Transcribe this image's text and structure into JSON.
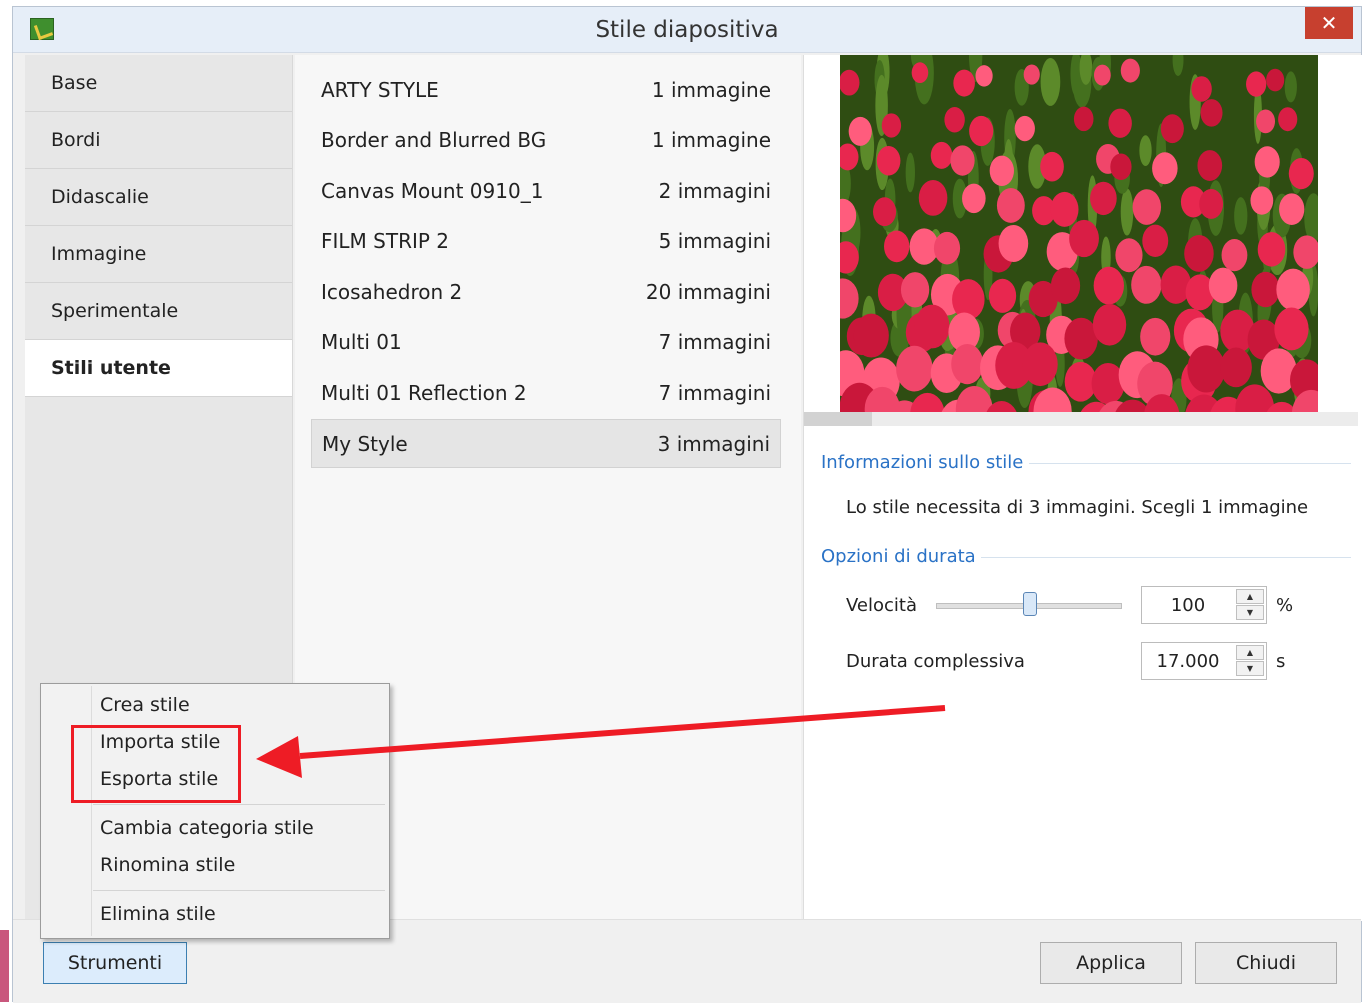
{
  "window": {
    "title": "Stile diapositiva",
    "close_glyph": "✕"
  },
  "sidebar": {
    "items": [
      {
        "label": "Base"
      },
      {
        "label": "Bordi"
      },
      {
        "label": "Didascalie"
      },
      {
        "label": "Immagine"
      },
      {
        "label": "Sperimentale"
      },
      {
        "label": "Stili utente",
        "active": true
      }
    ]
  },
  "styles": [
    {
      "name": "ARTY STYLE",
      "count": "1 immagine"
    },
    {
      "name": "Border and Blurred BG",
      "count": "1 immagine"
    },
    {
      "name": "Canvas Mount 0910_1",
      "count": "2 immagini"
    },
    {
      "name": "FILM STRIP 2",
      "count": "5 immagini"
    },
    {
      "name": "Icosahedron 2",
      "count": "20 immagini"
    },
    {
      "name": "Multi 01",
      "count": "7 immagini"
    },
    {
      "name": "Multi 01 Reflection 2",
      "count": "7 immagini"
    },
    {
      "name": "My Style",
      "count": "3 immagini",
      "selected": true
    }
  ],
  "info": {
    "section_title": "Informazioni sullo stile",
    "text": "Lo stile necessita di 3 immagini. Scegli 1 immagine"
  },
  "duration": {
    "section_title": "Opzioni di durata",
    "speed_label": "Velocità",
    "speed_value": "100",
    "speed_unit": "%",
    "speed_slider_fraction": 0.5,
    "total_label": "Durata complessiva",
    "total_value": "17.000",
    "total_unit": "s"
  },
  "buttons": {
    "tools": "Strumenti",
    "apply": "Applica",
    "close": "Chiudi"
  },
  "context_menu": {
    "items": [
      {
        "label": "Crea stile"
      },
      {
        "label": "Importa stile"
      },
      {
        "label": "Esporta stile"
      },
      {
        "label": "Cambia categoria stile"
      },
      {
        "label": "Rinomina stile"
      },
      {
        "label": "Elimina stile"
      }
    ]
  },
  "annotation": {
    "color": "#ee1c25"
  },
  "colors": {
    "accent": "#2a72c6",
    "close": "#c7402f",
    "primary_border": "#3c7fb1"
  },
  "icons": {
    "spin_up": "▲",
    "spin_down": "▼"
  }
}
